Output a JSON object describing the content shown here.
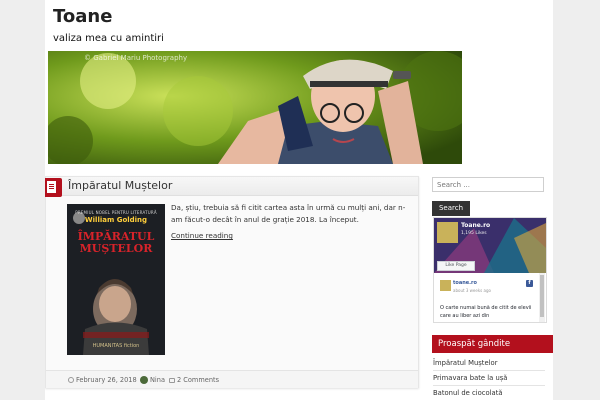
{
  "site": {
    "title": "Toane",
    "description": "valiza mea cu amintiri",
    "banner_watermark": "© Gabriel Mariu Photography"
  },
  "post": {
    "title": "Împăratul Muștelor",
    "excerpt": "Da, știu, trebuia să fi citit cartea asta în urmă cu mulți ani, dar n-am făcut-o decât în anul de grație 2018. La început.",
    "continue_label": "Continue reading",
    "date": "February 26, 2018",
    "author": "Nina",
    "comments": "2 Comments",
    "book": {
      "series_line": "PREMIUL NOBEL PENTRU LITERATURĂ",
      "author": "William Golding",
      "title": "ÎMPĂRATUL MUȘTELOR",
      "publisher": "HUMANITAS fiction"
    }
  },
  "sidebar": {
    "search_placeholder": "Search ...",
    "search_button": "Search",
    "facebook": {
      "page_name": "Toane.ro",
      "likes": "1,195 Likes",
      "like_button": "Like Page",
      "post_author": "toane.ro",
      "post_time": "about 3 weeks ago",
      "post_text": "O carte numai bună de citit de elevii care au liber azi din"
    },
    "recent_heading": "Proaspăt gândite",
    "recent": [
      "Împăratul Muștelor",
      "Primavara bate la ușă",
      "Batonul de ciocolată"
    ]
  },
  "colors": {
    "accent": "#b3101d",
    "dark": "#333333"
  }
}
